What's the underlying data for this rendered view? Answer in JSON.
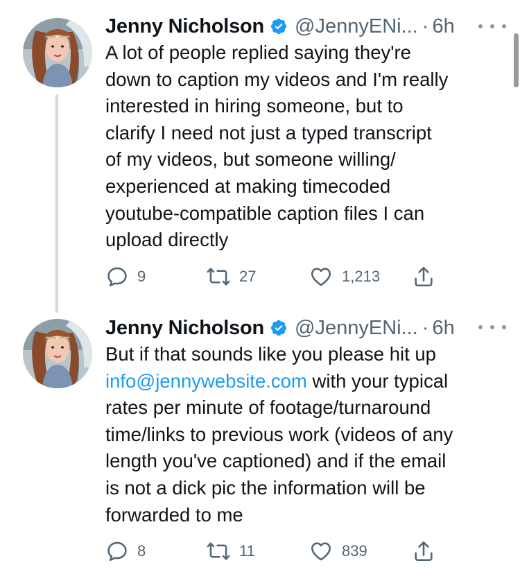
{
  "tweets": [
    {
      "author": {
        "name": "Jenny Nicholson",
        "handle": "@JennyENi...",
        "verified": true
      },
      "separator": "·",
      "time": "6h",
      "text_lines": [
        "A lot of people replied saying they're",
        "down to caption my videos and I'm really",
        "interested in hiring someone, but to",
        "clarify I need not just a typed transcript",
        "of my videos, but someone willing/",
        "experienced at making timecoded",
        "youtube-compatible caption files I can",
        "upload directly"
      ],
      "stats": {
        "replies": "9",
        "retweets": "27",
        "likes": "1,213"
      }
    },
    {
      "author": {
        "name": "Jenny Nicholson",
        "handle": "@JennyENi...",
        "verified": true
      },
      "separator": "·",
      "time": "6h",
      "text_lines": [
        "But if that sounds like you please hit up",
        "with your typical",
        "rates per minute of footage/turnaround",
        "time/links to previous work (videos of any",
        "length you've captioned) and if the email",
        "is not a dick pic the information will be",
        "forwarded to me"
      ],
      "link_text": "info@jennywebsite.com",
      "stats": {
        "replies": "8",
        "retweets": "11",
        "likes": "839"
      }
    }
  ],
  "icons": {
    "reply": "reply-icon",
    "retweet": "retweet-icon",
    "like": "heart-icon",
    "share": "share-icon",
    "more": "more-icon",
    "verified": "verified-badge-icon"
  },
  "colors": {
    "text": "#0f1419",
    "secondary": "#536471",
    "link": "#1d9bf0",
    "verified": "#1d9bf0",
    "thread_line": "#cfd9de"
  }
}
